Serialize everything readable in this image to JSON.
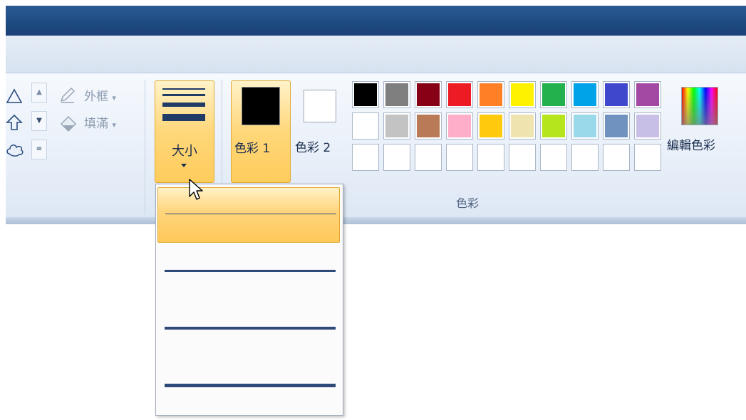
{
  "title_bar": {},
  "shapes_group": {
    "shape_icons": [
      "triangle-icon",
      "up-arrow-icon",
      "cloud-icon"
    ],
    "scroll_up": "▲",
    "scroll_down": "▼",
    "scroll_more": "≡"
  },
  "tools": {
    "outline_label": "外框",
    "fill_label": "填滿",
    "dropdown_marker": "▾"
  },
  "size_button": {
    "label": "大小"
  },
  "color1_button": {
    "label": "色彩 1",
    "color": "#000000"
  },
  "color2_button": {
    "label": "色彩 2",
    "color": "#ffffff"
  },
  "palette": {
    "row1": [
      "#000000",
      "#7f7f7f",
      "#880015",
      "#ed1c24",
      "#ff7f27",
      "#fff200",
      "#22b14c",
      "#00a2e8",
      "#3f48cc",
      "#a349a4"
    ],
    "row2": [
      "#ffffff",
      "#c3c3c3",
      "#b97a57",
      "#ffaec9",
      "#ffc90e",
      "#efe4b0",
      "#b5e61d",
      "#99d9ea",
      "#7092be",
      "#c8bfe7"
    ],
    "row3": [
      "",
      "",
      "",
      "",
      "",
      "",
      "",
      "",
      "",
      ""
    ]
  },
  "colors_group_label": "色彩",
  "edit_colors": {
    "label": "編輯色彩"
  },
  "size_dropdown": {
    "options": [
      "size-1px",
      "size-3px",
      "size-5px",
      "size-8px"
    ],
    "selected_index": 0
  }
}
